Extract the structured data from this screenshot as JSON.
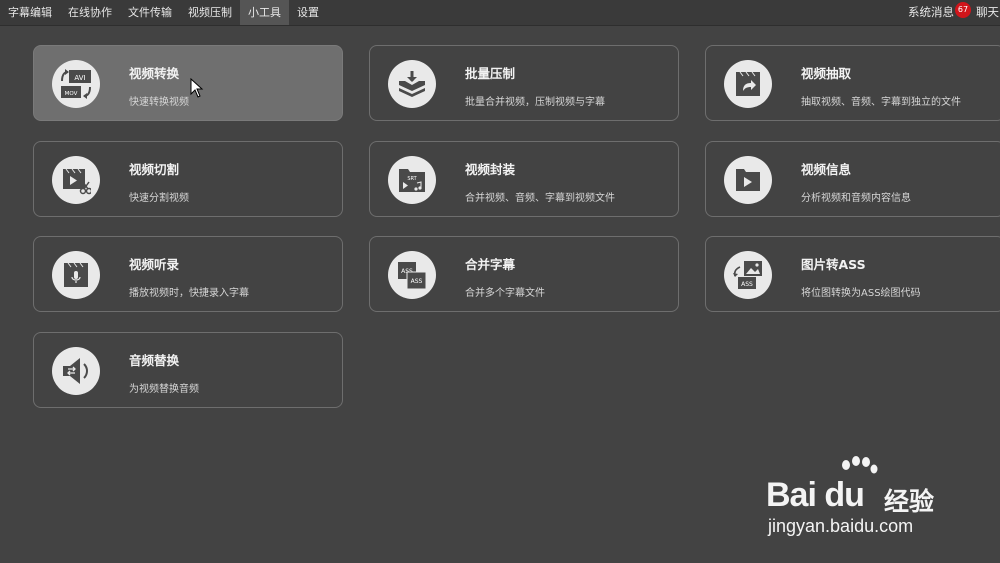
{
  "menu": {
    "items": [
      "字幕编辑",
      "在线协作",
      "文件传输",
      "视频压制",
      "小工具",
      "设置"
    ],
    "active_index": 4
  },
  "header_right": {
    "messages_label": "系统消息",
    "messages_count": "67",
    "chat_label": "聊天"
  },
  "tools": [
    {
      "title": "视频转换",
      "desc": "快速转换视频",
      "icon": "video-convert-icon",
      "active": true
    },
    {
      "title": "批量压制",
      "desc": "批量合并视频，压制视频与字幕",
      "icon": "batch-compress-icon"
    },
    {
      "title": "视频抽取",
      "desc": "抽取视频、音频、字幕到独立的文件",
      "icon": "video-extract-icon"
    },
    {
      "title": "视频切割",
      "desc": "快速分割视频",
      "icon": "video-cut-icon"
    },
    {
      "title": "视频封装",
      "desc": "合并视频、音频、字幕到视频文件",
      "icon": "video-mux-icon",
      "icon_text": "SRT"
    },
    {
      "title": "视频信息",
      "desc": "分析视频和音频内容信息",
      "icon": "video-info-icon"
    },
    {
      "title": "视频听录",
      "desc": "播放视频时，快捷录入字幕",
      "icon": "video-transcribe-icon"
    },
    {
      "title": "合并字幕",
      "desc": "合并多个字幕文件",
      "icon": "merge-subtitle-icon",
      "icon_text": "ASS"
    },
    {
      "title": "图片转ASS",
      "desc": "将位图转换为ASS绘图代码",
      "icon": "image-to-ass-icon",
      "icon_text": "ASS"
    },
    {
      "title": "音频替换",
      "desc": "为视频替换音频",
      "icon": "audio-replace-icon"
    }
  ],
  "video_convert_icon_text": {
    "avi": "AVI",
    "mov": "MOV"
  },
  "colors": {
    "background": "#434343",
    "card_active": "#6f6f6f",
    "badge": "#d0151b"
  },
  "watermark": {
    "brand": "Bai du",
    "cn": "经验",
    "url": "jingyan.baidu.com"
  }
}
